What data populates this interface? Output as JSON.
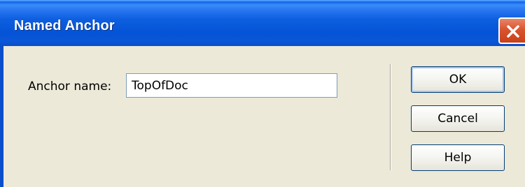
{
  "window": {
    "title": "Named Anchor"
  },
  "form": {
    "anchor_label": "Anchor name:",
    "anchor_value": "TopOfDoc"
  },
  "buttons": {
    "ok": "OK",
    "cancel": "Cancel",
    "help": "Help"
  },
  "icons": {
    "close": "close-icon"
  },
  "colors": {
    "titlebar": "#0553d6",
    "close_button": "#d9542e",
    "dialog_background": "#ece9d8"
  }
}
